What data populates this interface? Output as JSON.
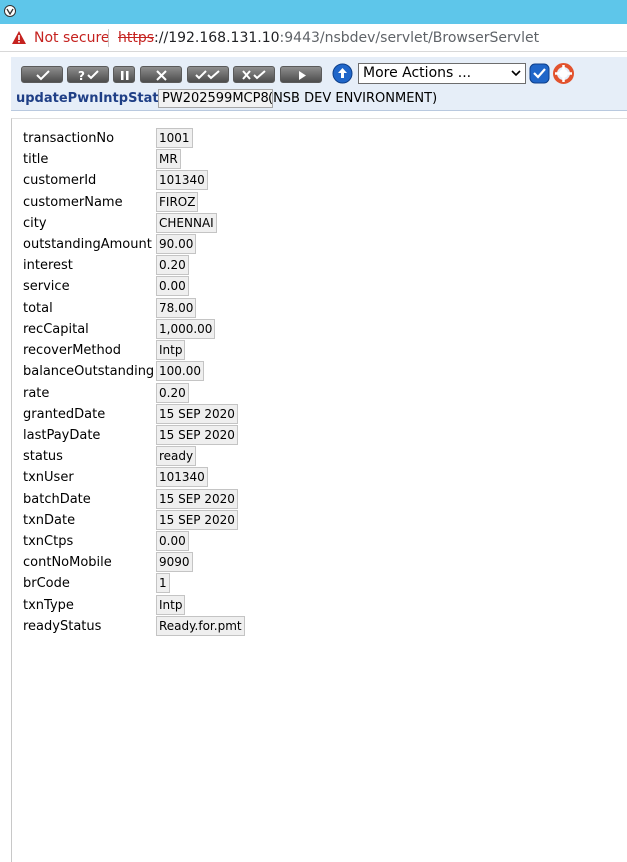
{
  "browser": {
    "security_label": "Not secure",
    "url_scheme": "https",
    "url_host": "://192.168.131.10",
    "url_rest": ":9443/nsbdev/servlet/BrowserServlet"
  },
  "toolbar": {
    "more_actions": "More Actions ..."
  },
  "service": {
    "name": "updatePwnIntpStatus",
    "id": "PW202599MCP8",
    "environment": "(NSB DEV ENVIRONMENT)"
  },
  "fields": [
    {
      "label": "transactionNo",
      "value": "1001"
    },
    {
      "label": "title",
      "value": "MR"
    },
    {
      "label": "customerId",
      "value": "101340"
    },
    {
      "label": "customerName",
      "value": "FIROZ"
    },
    {
      "label": "city",
      "value": "CHENNAI"
    },
    {
      "label": "outstandingAmount",
      "value": "90.00"
    },
    {
      "label": "interest",
      "value": "0.20"
    },
    {
      "label": "service",
      "value": "0.00"
    },
    {
      "label": "total",
      "value": "78.00"
    },
    {
      "label": "recCapital",
      "value": "1,000.00"
    },
    {
      "label": "recoverMethod",
      "value": "Intp"
    },
    {
      "label": "balanceOutstanding",
      "value": "100.00"
    },
    {
      "label": "rate",
      "value": "0.20"
    },
    {
      "label": "grantedDate",
      "value": "15 SEP 2020"
    },
    {
      "label": "lastPayDate",
      "value": "15 SEP 2020"
    },
    {
      "label": "status",
      "value": "ready"
    },
    {
      "label": "txnUser",
      "value": "101340"
    },
    {
      "label": "batchDate",
      "value": "15 SEP 2020"
    },
    {
      "label": "txnDate",
      "value": "15 SEP 2020"
    },
    {
      "label": "txnCtps",
      "value": "0.00"
    },
    {
      "label": "contNoMobile",
      "value": "9090"
    },
    {
      "label": "brCode",
      "value": "1"
    },
    {
      "label": "txnType",
      "value": "Intp"
    },
    {
      "label": "readyStatus",
      "value": "Ready.for.pmt"
    }
  ],
  "colors": {
    "titlebar": "#5ec6ea",
    "warning": "#c5221f",
    "service_name": "#1f3f86",
    "toolbar_bg": "#e6eef8"
  }
}
